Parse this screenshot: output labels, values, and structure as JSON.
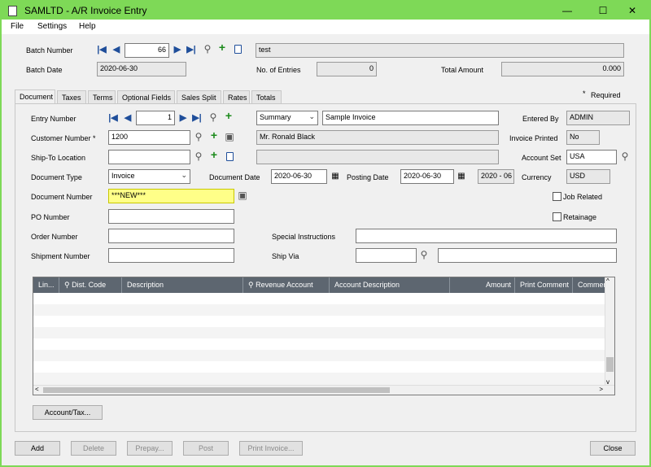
{
  "window": {
    "title": "SAMLTD - A/R Invoice Entry",
    "minimize": "—",
    "maximize": "☐",
    "close": "✕",
    "accent_color": "#7ed957"
  },
  "menu": [
    "File",
    "Settings",
    "Help"
  ],
  "header": {
    "batch_number_label": "Batch Number",
    "batch_number": "66",
    "batch_description": "test",
    "batch_date_label": "Batch Date",
    "batch_date": "2020-06-30",
    "entries_label": "No. of Entries",
    "entries": "0",
    "total_amount_label": "Total Amount",
    "total_amount": "0.000"
  },
  "required_note": "Required",
  "tabs": [
    "Document",
    "Taxes",
    "Terms",
    "Optional Fields",
    "Sales Split",
    "Rates",
    "Totals"
  ],
  "document": {
    "entry_number_label": "Entry Number",
    "entry_number": "1",
    "entry_mode": "Summary",
    "entry_description": "Sample Invoice",
    "entered_by_label": "Entered By",
    "entered_by": "ADMIN",
    "customer_number_label": "Customer Number",
    "customer_number": "1200",
    "customer_name": "Mr. Ronald Black",
    "invoice_printed_label": "Invoice Printed",
    "invoice_printed": "No",
    "ship_to_label": "Ship-To Location",
    "ship_to": "",
    "ship_to_name": "",
    "account_set_label": "Account Set",
    "account_set": "USA",
    "document_type_label": "Document Type",
    "document_type": "Invoice",
    "document_date_label": "Document Date",
    "document_date": "2020-06-30",
    "posting_date_label": "Posting Date",
    "posting_date": "2020-06-30",
    "fiscal_period": "2020 - 06",
    "currency_label": "Currency",
    "currency": "USD",
    "document_number_label": "Document Number",
    "document_number": "***NEW***",
    "job_related_label": "Job Related",
    "po_number_label": "PO Number",
    "po_number": "",
    "retainage_label": "Retainage",
    "order_number_label": "Order Number",
    "order_number": "",
    "special_instructions_label": "Special Instructions",
    "special_instructions": "",
    "shipment_number_label": "Shipment Number",
    "shipment_number": "",
    "ship_via_label": "Ship Via",
    "ship_via": "",
    "ship_via_desc": ""
  },
  "grid": {
    "columns": [
      "Lin...",
      "Dist. Code",
      "Description",
      "Revenue Account",
      "Account Description",
      "Amount",
      "Print Comment",
      "Commen"
    ]
  },
  "buttons": {
    "account_tax": "Account/Tax...",
    "add": "Add",
    "delete": "Delete",
    "prepay": "Prepay...",
    "post": "Post",
    "print_invoice": "Print Invoice...",
    "close": "Close"
  }
}
